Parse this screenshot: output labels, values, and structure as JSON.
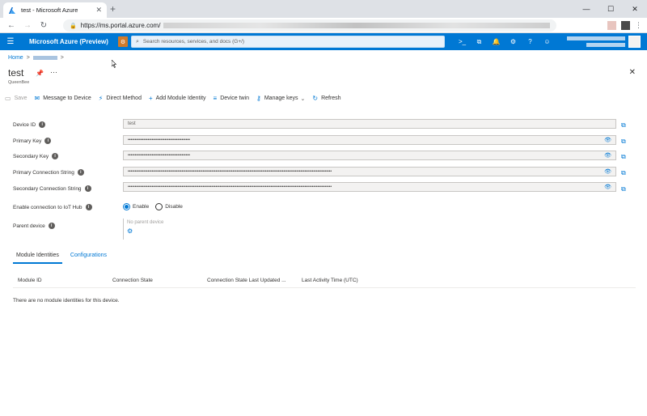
{
  "browser": {
    "tab_title": "test - Microsoft Azure",
    "url_prefix": "https://ms.portal.azure.com/",
    "window_controls": [
      "—",
      "☐",
      "✕"
    ]
  },
  "azure": {
    "brand": "Microsoft Azure (Preview)",
    "search_placeholder": "Search resources, services, and docs (G+/)",
    "header_icons": [
      "cloud-shell-icon",
      "directory-filter-icon",
      "notifications-icon",
      "settings-icon",
      "help-icon",
      "feedback-icon"
    ]
  },
  "breadcrumb": {
    "home": "Home",
    "sep1": ">",
    "sep2": ">"
  },
  "blade": {
    "title": "test",
    "subtitle": "QueenBee",
    "more": "···",
    "close": "✕"
  },
  "commands": [
    {
      "label": "Save",
      "icon": "save-icon",
      "enabled": false
    },
    {
      "label": "Message to Device",
      "icon": "message-icon",
      "enabled": true
    },
    {
      "label": "Direct Method",
      "icon": "direct-method-icon",
      "enabled": true
    },
    {
      "label": "Add Module Identity",
      "icon": "add-icon",
      "enabled": true
    },
    {
      "label": "Device twin",
      "icon": "device-twin-icon",
      "enabled": true
    },
    {
      "label": "Manage keys",
      "icon": "key-icon",
      "enabled": true
    },
    {
      "label": "Refresh",
      "icon": "refresh-icon",
      "enabled": true
    }
  ],
  "fields": [
    {
      "label": "Device ID",
      "value": "test",
      "secret": false
    },
    {
      "label": "Primary Key",
      "value": "••••••••••••••••••••••••••••••••••••••••••••",
      "secret": true
    },
    {
      "label": "Secondary Key",
      "value": "••••••••••••••••••••••••••••••••••••••••••••",
      "secret": true
    },
    {
      "label": "Primary Connection String",
      "value": "••••••••••••••••••••••••••••••••••••••••••••••••••••••••••••••••••••••••••••••••••••••••••••••••••••••••••••••••••••••••••••••••••••••••••••••••",
      "secret": true
    },
    {
      "label": "Secondary Connection String",
      "value": "••••••••••••••••••••••••••••••••••••••••••••••••••••••••••••••••••••••••••••••••••••••••••••••••••••••••••••••••••••••••••••••••••••••••••••••••",
      "secret": true
    }
  ],
  "connection": {
    "label": "Enable connection to IoT Hub",
    "enable": "Enable",
    "disable": "Disable",
    "selected": "Enable"
  },
  "parent": {
    "label": "Parent device",
    "value": "No parent device"
  },
  "tabs": [
    {
      "label": "Module Identities",
      "active": true
    },
    {
      "label": "Configurations",
      "active": false
    }
  ],
  "grid": {
    "columns": [
      "Module ID",
      "Connection State",
      "Connection State Last Updated ...",
      "Last Activity Time (UTC)"
    ],
    "empty_message": "There are no module identities for this device."
  }
}
